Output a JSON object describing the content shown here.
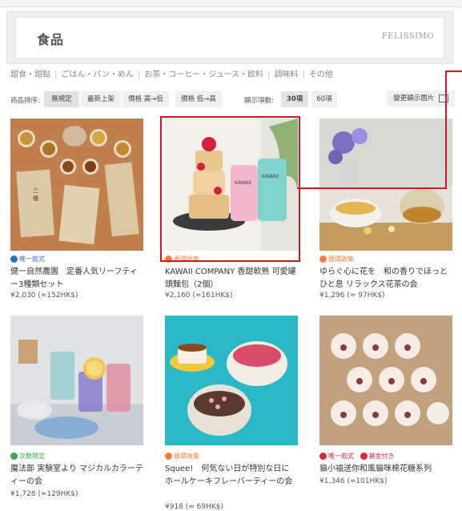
{
  "page": {
    "title": "食品",
    "brand": "FELISSIMO"
  },
  "categories": [
    "甜食・甜點",
    "ごはん・パン・めん",
    "お茶・コーヒー・ジュース・飲料",
    "調味料",
    "その他"
  ],
  "sort": {
    "label": "商品排序:",
    "options": [
      "無規定",
      "最新上架",
      "價格 高→低",
      "價格 低→高"
    ],
    "active_index": 0,
    "count_label": "顯示項數:",
    "counts": [
      "30項",
      "60項"
    ],
    "count_selected_index": 0,
    "view_button": "變更顯示圖片"
  },
  "products": [
    {
      "tags": [
        {
          "text": "唯一款式",
          "color": "blue"
        }
      ],
      "name": "健一自然農園　定番人気リーフティー3種類セット",
      "price": "¥2,030 (≈152HK$)"
    },
    {
      "tags": [
        {
          "text": "循環收集",
          "color": "orange"
        }
      ],
      "name": "KAWAII COMPANY 香甜軟熟 可愛罐頭麵包（2個）",
      "price": "¥2,160 (≈161HK$)"
    },
    {
      "tags": [
        {
          "text": "循環收集",
          "color": "orange"
        }
      ],
      "name": "ゆらぐ心に花を　和の香りでほっとひと息 リラックス花茶の会",
      "price": "¥1,296 (≈ 97HK$)"
    },
    {
      "tags": [
        {
          "text": "次數限定",
          "color": "green"
        }
      ],
      "name": "魔法部 実験室より マジカルカラーティーの会",
      "price": "¥1,728 (≈129HK$)"
    },
    {
      "tags": [
        {
          "text": "循環收集",
          "color": "orange"
        }
      ],
      "name": "Squee!　何気ない日が特別な日に ホールケーキフレーバーティーの会",
      "price": "¥918 (≈ 69HK$)"
    },
    {
      "tags": [
        {
          "text": "唯一款式",
          "color": "red"
        },
        {
          "text": "基金付き",
          "color": "red"
        }
      ],
      "name": "貓小福送你和風貓咪棉花糖系列",
      "price": "¥1,346 (≈101HK$)"
    }
  ]
}
